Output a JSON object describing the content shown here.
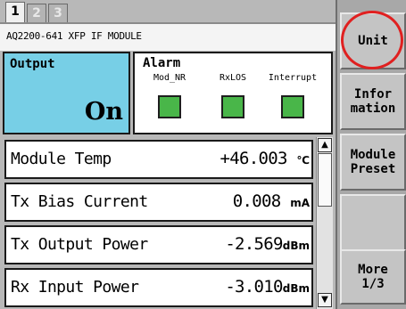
{
  "tabs": [
    {
      "label": "1",
      "active": true
    },
    {
      "label": "2",
      "active": false
    },
    {
      "label": "3",
      "active": false
    }
  ],
  "module": {
    "title": "AQ2200-641 XFP  IF MODULE"
  },
  "output": {
    "label": "Output",
    "value": "On"
  },
  "alarm": {
    "label": "Alarm",
    "items": [
      {
        "label": "Mod_NR",
        "color": "#49b649"
      },
      {
        "label": "RxLOS",
        "color": "#49b649"
      },
      {
        "label": "Interrupt",
        "color": "#49b649"
      }
    ]
  },
  "measurements": [
    {
      "label": "Module Temp",
      "value": "+46.003",
      "unit": "℃"
    },
    {
      "label": "Tx Bias Current",
      "value": "0.008",
      "unit": "mA"
    },
    {
      "label": "Tx Output Power",
      "value": "-2.569",
      "unit": "dBm"
    },
    {
      "label": "Rx Input Power",
      "value": "-3.010",
      "unit": "dBm"
    }
  ],
  "scroll": {
    "up_icon": "▲",
    "down_icon": "▼"
  },
  "softkeys": {
    "unit": "Unit",
    "information": "Infor\nmation",
    "module_preset": "Module\nPreset",
    "blank": "",
    "more": "More\n1/3"
  },
  "colors": {
    "output_bg": "#77cfe6",
    "led_ok": "#49b649",
    "highlight": "#e02020"
  }
}
